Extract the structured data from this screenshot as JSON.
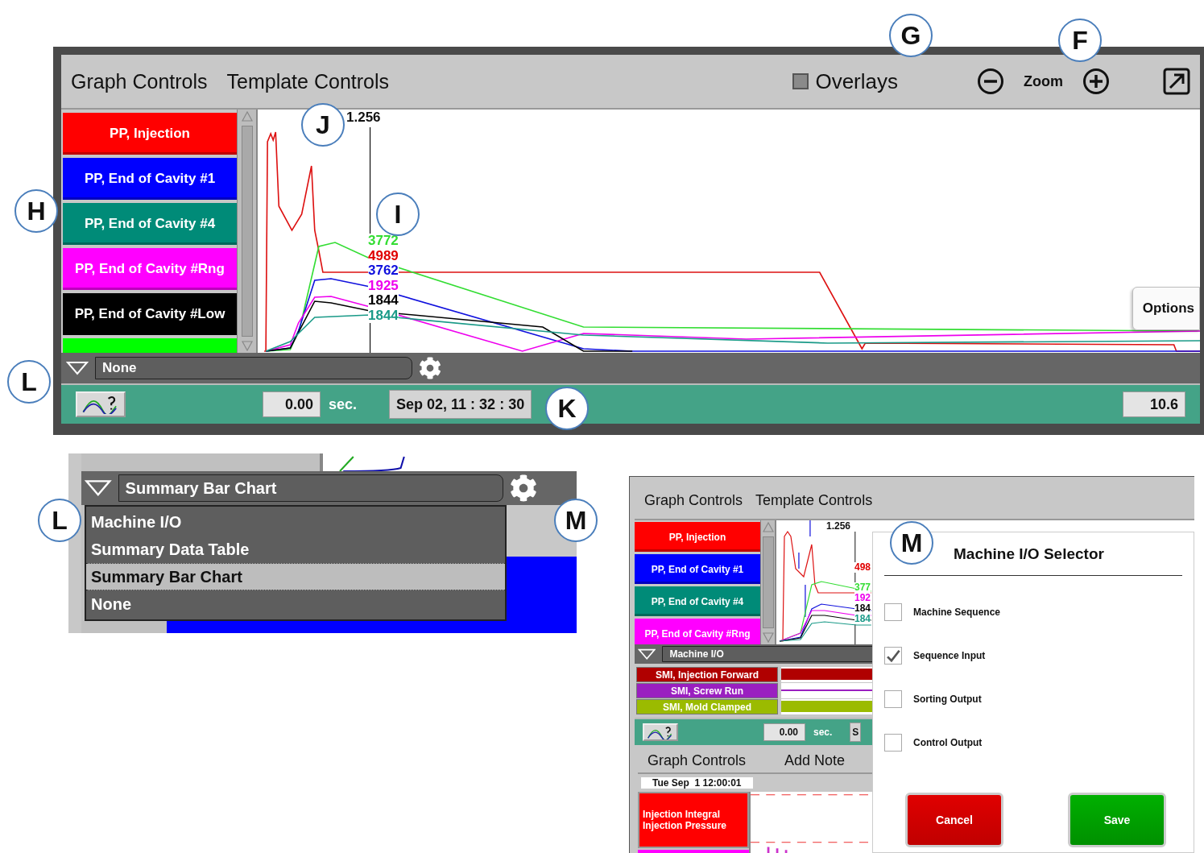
{
  "callouts": [
    {
      "letter": "G"
    },
    {
      "letter": "F"
    },
    {
      "letter": "J"
    },
    {
      "letter": "H"
    },
    {
      "letter": "I"
    },
    {
      "letter": "L"
    },
    {
      "letter": "K"
    },
    {
      "letter": "L"
    },
    {
      "letter": "M"
    },
    {
      "letter": "M"
    }
  ],
  "main_screen": {
    "menu": [
      "Graph Controls",
      "Template Controls"
    ],
    "overlays": {
      "label": "Overlays",
      "checked": false
    },
    "zoom_label": "Zoom",
    "legend": [
      {
        "label": "PP, Injection",
        "color": "#ff0000"
      },
      {
        "label": "PP, End of Cavity #1",
        "color": "#0000ff"
      },
      {
        "label": "PP, End of Cavity #4",
        "color": "#008b78"
      },
      {
        "label": "PP, End of Cavity #Rng",
        "color": "#ff00ff"
      },
      {
        "label": "PP, End of Cavity #Low",
        "color": "#000000"
      },
      {
        "color": "#00ff00"
      }
    ],
    "cursor_value": "1.256",
    "readings": [
      {
        "text": "3772",
        "color": "#33dd33"
      },
      {
        "text": "4989",
        "color": "#e00000"
      },
      {
        "text": "3762",
        "color": "#1010dd"
      },
      {
        "text": "1925",
        "color": "#ee00ee"
      },
      {
        "text": "1844",
        "color": "#000000"
      },
      {
        "text": "1844",
        "color": "#1a9a88"
      }
    ],
    "options_button": "Options",
    "view_select": "None",
    "status": {
      "time": "0.00",
      "unit": "sec.",
      "timestamp": "Sep 02, 11 : 32 : 30",
      "end_time": "10.6"
    }
  },
  "dropdown_screen": {
    "value": "Summary Bar Chart",
    "options": [
      {
        "label": "Machine I/O",
        "selected": false
      },
      {
        "label": "Summary Data Table",
        "selected": false
      },
      {
        "label": "Summary Bar Chart",
        "selected": true
      },
      {
        "label": "None",
        "selected": false
      }
    ]
  },
  "io_screen": {
    "menu": [
      "Graph Controls",
      "Template Controls"
    ],
    "legend": [
      {
        "label": "PP, Injection",
        "color": "#ff0000"
      },
      {
        "label": "PP, End of Cavity #1",
        "color": "#0000ff"
      },
      {
        "label": "PP, End of Cavity #4",
        "color": "#008b78"
      },
      {
        "label": "PP, End of Cavity #Rng",
        "color": "#ff00ff"
      }
    ],
    "cursor_value": "1.256",
    "readings": [
      {
        "text": "498",
        "color": "#e00000"
      },
      {
        "text": "377",
        "color": "#33dd33"
      },
      {
        "text": "192",
        "color": "#ee00ee"
      },
      {
        "text": "184",
        "color": "#000000"
      },
      {
        "text": "184",
        "color": "#1a9a88"
      }
    ],
    "view_select": "Machine I/O",
    "io_rows": [
      {
        "label": "SMI, Injection Forward",
        "color": "#b00000"
      },
      {
        "label": "SMI, Screw Run",
        "color": "#9a1fc0"
      },
      {
        "label": "SMI, Mold Clamped",
        "color": "#9bbb00"
      }
    ],
    "status": {
      "time": "0.00",
      "unit": "sec.",
      "cut_text": "S"
    },
    "second_graph": {
      "menu": [
        "Graph Controls",
        "Add Note"
      ],
      "timestamp": "Tue Sep  1 12:00:01",
      "legend_lines": [
        "Injection Integral",
        "Injection Pressure"
      ]
    },
    "dialog": {
      "title": "Machine I/O Selector",
      "options": [
        {
          "label": "Machine Sequence",
          "checked": false
        },
        {
          "label": "Sequence Input",
          "checked": true
        },
        {
          "label": "Sorting Output",
          "checked": false
        },
        {
          "label": "Control Output",
          "checked": false
        }
      ],
      "buttons": [
        {
          "label": "Cancel",
          "kind": "cancel"
        },
        {
          "label": "Save",
          "kind": "save"
        }
      ]
    }
  }
}
